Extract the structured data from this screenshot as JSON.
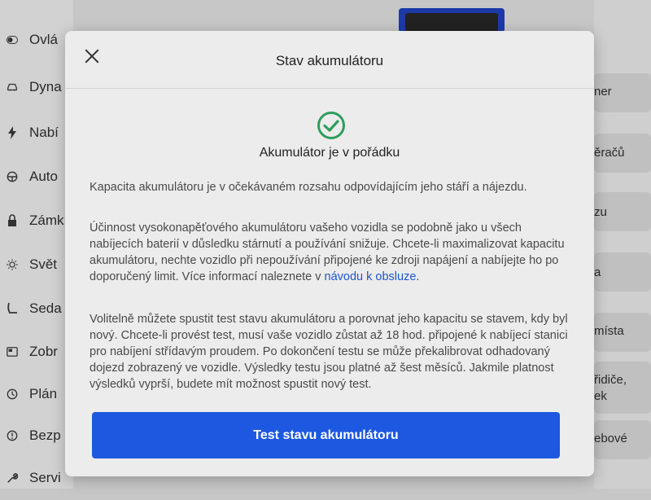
{
  "sidebar": {
    "items": [
      {
        "label": "Ovlá",
        "icon": "toggle-icon"
      },
      {
        "label": "Dyna",
        "icon": "car-icon"
      },
      {
        "label": "Nabí",
        "icon": "lightning-icon"
      },
      {
        "label": "Auto",
        "icon": "steering-wheel-icon"
      },
      {
        "label": "Zámk",
        "icon": "lock-icon"
      },
      {
        "label": "Svět",
        "icon": "sun-icon"
      },
      {
        "label": "Seda",
        "icon": "seat-icon"
      },
      {
        "label": "Zobr",
        "icon": "display-icon"
      },
      {
        "label": "Plán",
        "icon": "clock-icon"
      },
      {
        "label": "Bezp",
        "icon": "info-circle-icon"
      },
      {
        "label": "Servi",
        "icon": "wrench-icon"
      }
    ]
  },
  "right_tiles": [
    {
      "label": "ner"
    },
    {
      "label": "ěračů"
    },
    {
      "label": "zu"
    },
    {
      "label": "a"
    },
    {
      "label": "místa"
    },
    {
      "label": "řidiče,",
      "label2": "ek"
    },
    {
      "label": "ebové"
    }
  ],
  "modal": {
    "title": "Stav akumulátoru",
    "status_text": "Akumulátor je v pořádku",
    "paragraph1": "Kapacita akumulátoru je v očekávaném rozsahu odpovídajícím jeho stáří a nájezdu.",
    "paragraph2": "Účinnost vysokonapěťového akumulátoru vašeho vozidla se podobně jako u všech nabíjecích baterií v důsledku stárnutí a používání snižuje. Chcete-li maximalizovat kapacitu akumulátoru, nechte vozidlo při nepoužívání připojené ke zdroji napájení a nabíjejte ho po doporučený limit. Více informací naleznete v ",
    "paragraph2_link": "návodu k obsluze",
    "paragraph2_end": ".",
    "paragraph3": "Volitelně můžete spustit test stavu akumulátoru a porovnat jeho kapacitu se stavem, kdy byl nový. Chcete-li provést test, musí vaše vozidlo zůstat až 18 hod. připojené k nabíjecí stanici pro nabíjení střídavým proudem. Po dokončení testu se může překalibrovat odhadovaný dojezd zobrazený ve vozidle. Výsledky testu jsou platné až šest měsíců. Jakmile platnost výsledků vyprší, budete mít možnost spustit nový test.",
    "button_label": "Test stavu akumulátoru"
  },
  "colors": {
    "accent": "#1d58e0",
    "link": "#1e56cc",
    "success": "#2e9e5b",
    "modal_bg": "#ececec"
  }
}
